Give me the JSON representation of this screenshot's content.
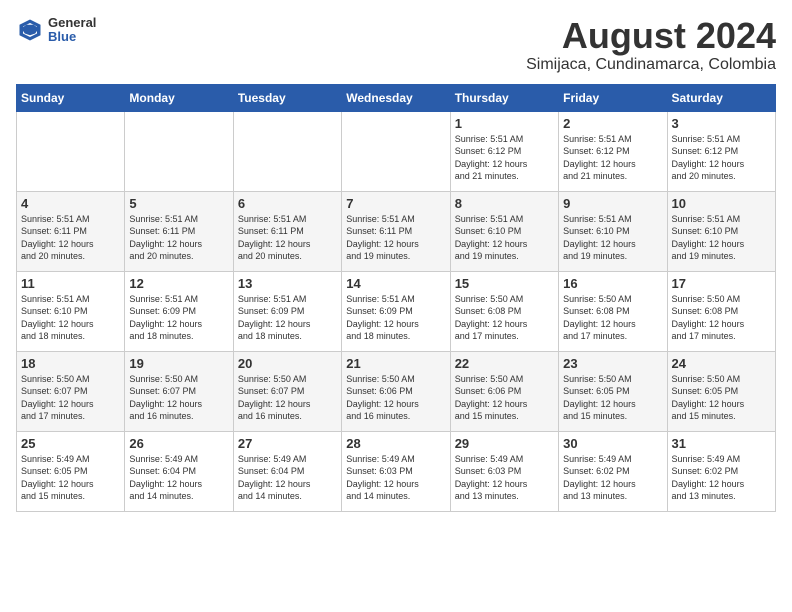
{
  "header": {
    "logo_general": "General",
    "logo_blue": "Blue",
    "title": "August 2024",
    "subtitle": "Simijaca, Cundinamarca, Colombia"
  },
  "days_of_week": [
    "Sunday",
    "Monday",
    "Tuesday",
    "Wednesday",
    "Thursday",
    "Friday",
    "Saturday"
  ],
  "weeks": [
    [
      {
        "day": "",
        "info": ""
      },
      {
        "day": "",
        "info": ""
      },
      {
        "day": "",
        "info": ""
      },
      {
        "day": "",
        "info": ""
      },
      {
        "day": "1",
        "info": "Sunrise: 5:51 AM\nSunset: 6:12 PM\nDaylight: 12 hours\nand 21 minutes."
      },
      {
        "day": "2",
        "info": "Sunrise: 5:51 AM\nSunset: 6:12 PM\nDaylight: 12 hours\nand 21 minutes."
      },
      {
        "day": "3",
        "info": "Sunrise: 5:51 AM\nSunset: 6:12 PM\nDaylight: 12 hours\nand 20 minutes."
      }
    ],
    [
      {
        "day": "4",
        "info": "Sunrise: 5:51 AM\nSunset: 6:11 PM\nDaylight: 12 hours\nand 20 minutes."
      },
      {
        "day": "5",
        "info": "Sunrise: 5:51 AM\nSunset: 6:11 PM\nDaylight: 12 hours\nand 20 minutes."
      },
      {
        "day": "6",
        "info": "Sunrise: 5:51 AM\nSunset: 6:11 PM\nDaylight: 12 hours\nand 20 minutes."
      },
      {
        "day": "7",
        "info": "Sunrise: 5:51 AM\nSunset: 6:11 PM\nDaylight: 12 hours\nand 19 minutes."
      },
      {
        "day": "8",
        "info": "Sunrise: 5:51 AM\nSunset: 6:10 PM\nDaylight: 12 hours\nand 19 minutes."
      },
      {
        "day": "9",
        "info": "Sunrise: 5:51 AM\nSunset: 6:10 PM\nDaylight: 12 hours\nand 19 minutes."
      },
      {
        "day": "10",
        "info": "Sunrise: 5:51 AM\nSunset: 6:10 PM\nDaylight: 12 hours\nand 19 minutes."
      }
    ],
    [
      {
        "day": "11",
        "info": "Sunrise: 5:51 AM\nSunset: 6:10 PM\nDaylight: 12 hours\nand 18 minutes."
      },
      {
        "day": "12",
        "info": "Sunrise: 5:51 AM\nSunset: 6:09 PM\nDaylight: 12 hours\nand 18 minutes."
      },
      {
        "day": "13",
        "info": "Sunrise: 5:51 AM\nSunset: 6:09 PM\nDaylight: 12 hours\nand 18 minutes."
      },
      {
        "day": "14",
        "info": "Sunrise: 5:51 AM\nSunset: 6:09 PM\nDaylight: 12 hours\nand 18 minutes."
      },
      {
        "day": "15",
        "info": "Sunrise: 5:50 AM\nSunset: 6:08 PM\nDaylight: 12 hours\nand 17 minutes."
      },
      {
        "day": "16",
        "info": "Sunrise: 5:50 AM\nSunset: 6:08 PM\nDaylight: 12 hours\nand 17 minutes."
      },
      {
        "day": "17",
        "info": "Sunrise: 5:50 AM\nSunset: 6:08 PM\nDaylight: 12 hours\nand 17 minutes."
      }
    ],
    [
      {
        "day": "18",
        "info": "Sunrise: 5:50 AM\nSunset: 6:07 PM\nDaylight: 12 hours\nand 17 minutes."
      },
      {
        "day": "19",
        "info": "Sunrise: 5:50 AM\nSunset: 6:07 PM\nDaylight: 12 hours\nand 16 minutes."
      },
      {
        "day": "20",
        "info": "Sunrise: 5:50 AM\nSunset: 6:07 PM\nDaylight: 12 hours\nand 16 minutes."
      },
      {
        "day": "21",
        "info": "Sunrise: 5:50 AM\nSunset: 6:06 PM\nDaylight: 12 hours\nand 16 minutes."
      },
      {
        "day": "22",
        "info": "Sunrise: 5:50 AM\nSunset: 6:06 PM\nDaylight: 12 hours\nand 15 minutes."
      },
      {
        "day": "23",
        "info": "Sunrise: 5:50 AM\nSunset: 6:05 PM\nDaylight: 12 hours\nand 15 minutes."
      },
      {
        "day": "24",
        "info": "Sunrise: 5:50 AM\nSunset: 6:05 PM\nDaylight: 12 hours\nand 15 minutes."
      }
    ],
    [
      {
        "day": "25",
        "info": "Sunrise: 5:49 AM\nSunset: 6:05 PM\nDaylight: 12 hours\nand 15 minutes."
      },
      {
        "day": "26",
        "info": "Sunrise: 5:49 AM\nSunset: 6:04 PM\nDaylight: 12 hours\nand 14 minutes."
      },
      {
        "day": "27",
        "info": "Sunrise: 5:49 AM\nSunset: 6:04 PM\nDaylight: 12 hours\nand 14 minutes."
      },
      {
        "day": "28",
        "info": "Sunrise: 5:49 AM\nSunset: 6:03 PM\nDaylight: 12 hours\nand 14 minutes."
      },
      {
        "day": "29",
        "info": "Sunrise: 5:49 AM\nSunset: 6:03 PM\nDaylight: 12 hours\nand 13 minutes."
      },
      {
        "day": "30",
        "info": "Sunrise: 5:49 AM\nSunset: 6:02 PM\nDaylight: 12 hours\nand 13 minutes."
      },
      {
        "day": "31",
        "info": "Sunrise: 5:49 AM\nSunset: 6:02 PM\nDaylight: 12 hours\nand 13 minutes."
      }
    ]
  ]
}
